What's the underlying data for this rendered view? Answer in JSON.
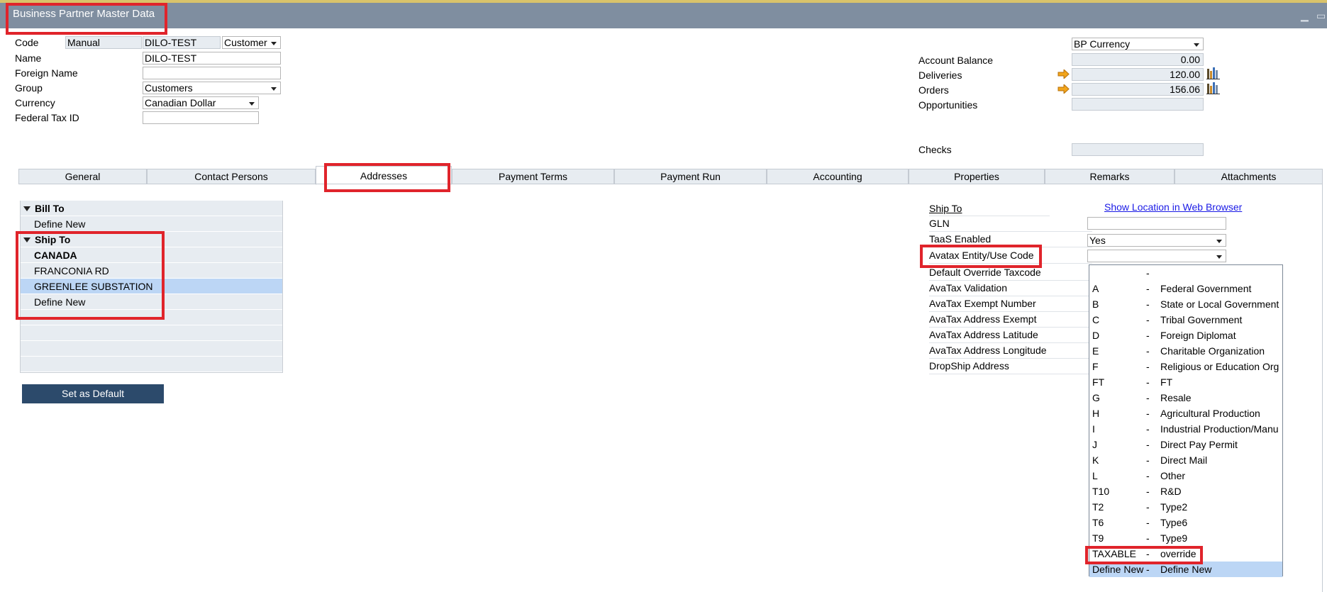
{
  "window": {
    "title": "Business Partner Master Data",
    "minimize_glyph": "▁",
    "restore_glyph": "▭"
  },
  "header": {
    "code_label": "Code",
    "code_series": "Manual",
    "code_value": "DILO-TEST",
    "bp_type": "Customer",
    "name_label": "Name",
    "name_value": "DILO-TEST",
    "foreign_name_label": "Foreign Name",
    "foreign_name_value": "",
    "group_label": "Group",
    "group_value": "Customers",
    "currency_label": "Currency",
    "currency_value": "Canadian Dollar",
    "federal_tax_label": "Federal Tax ID",
    "federal_tax_value": ""
  },
  "balance": {
    "currency_select": "BP Currency",
    "account_balance_label": "Account Balance",
    "account_balance_value": "0.00",
    "deliveries_label": "Deliveries",
    "deliveries_value": "120.00",
    "orders_label": "Orders",
    "orders_value": "156.06",
    "opportunities_label": "Opportunities",
    "opportunities_value": "",
    "checks_label": "Checks",
    "checks_value": ""
  },
  "tabs": [
    {
      "label": "General"
    },
    {
      "label": "Contact Persons"
    },
    {
      "label": "Addresses"
    },
    {
      "label": "Payment Terms"
    },
    {
      "label": "Payment Run"
    },
    {
      "label": "Accounting"
    },
    {
      "label": "Properties"
    },
    {
      "label": "Remarks"
    },
    {
      "label": "Attachments"
    }
  ],
  "address_tree": {
    "bill_to_label": "Bill To",
    "bill_define_new": "Define New",
    "ship_to_label": "Ship To",
    "ship_items": [
      "CANADA",
      "FRANCONIA RD",
      "GREENLEE SUBSTATION"
    ],
    "ship_define_new": "Define New",
    "set_default_button": "Set as Default"
  },
  "address_detail": {
    "ship_to_heading": "Ship To",
    "show_location_link": "Show Location in Web Browser",
    "gln_label": "GLN",
    "gln_value": "",
    "taas_label": "TaaS Enabled",
    "taas_value": "Yes",
    "avatax_entity_label": "Avatax Entity/Use Code",
    "avatax_entity_value": "",
    "default_override_label": "Default Override Taxcode",
    "avatax_validation_label": "AvaTax Validation",
    "avatax_exempt_number_label": "AvaTax Exempt Number",
    "avatax_address_exempt_label": "AvaTax Address Exempt",
    "avatax_latitude_label": "AvaTax Address Latitude",
    "avatax_longitude_label": "AvaTax Address Longitude",
    "dropship_label": "DropShip Address"
  },
  "entity_code_options": [
    {
      "code": "",
      "dash": "-",
      "name": ""
    },
    {
      "code": "A",
      "dash": "-",
      "name": "Federal Government"
    },
    {
      "code": "B",
      "dash": "-",
      "name": "State or Local Government"
    },
    {
      "code": "C",
      "dash": "-",
      "name": "Tribal Government"
    },
    {
      "code": "D",
      "dash": "-",
      "name": "Foreign Diplomat"
    },
    {
      "code": "E",
      "dash": "-",
      "name": "Charitable Organization"
    },
    {
      "code": "F",
      "dash": "-",
      "name": "Religious or Education Org"
    },
    {
      "code": "FT",
      "dash": "-",
      "name": "FT"
    },
    {
      "code": "G",
      "dash": "-",
      "name": "Resale"
    },
    {
      "code": "H",
      "dash": "-",
      "name": "Agricultural Production"
    },
    {
      "code": "I",
      "dash": "-",
      "name": "Industrial Production/Manu"
    },
    {
      "code": "J",
      "dash": "-",
      "name": "Direct Pay Permit"
    },
    {
      "code": "K",
      "dash": "-",
      "name": "Direct Mail"
    },
    {
      "code": "L",
      "dash": "-",
      "name": "Other"
    },
    {
      "code": "T10",
      "dash": "-",
      "name": "R&D"
    },
    {
      "code": "T2",
      "dash": "-",
      "name": "Type2"
    },
    {
      "code": "T6",
      "dash": "-",
      "name": "Type6"
    },
    {
      "code": "T9",
      "dash": "-",
      "name": "Type9"
    },
    {
      "code": "TAXABLE",
      "dash": "-",
      "name": "override"
    },
    {
      "code": "Define New",
      "dash": "-",
      "name": "Define New"
    }
  ],
  "colors": {
    "titlebar": "#7f8ea0",
    "highlight_box": "#e0242b",
    "selection": "#bcd6f5",
    "button": "#2c4a6b",
    "link": "#1a1ae6"
  }
}
